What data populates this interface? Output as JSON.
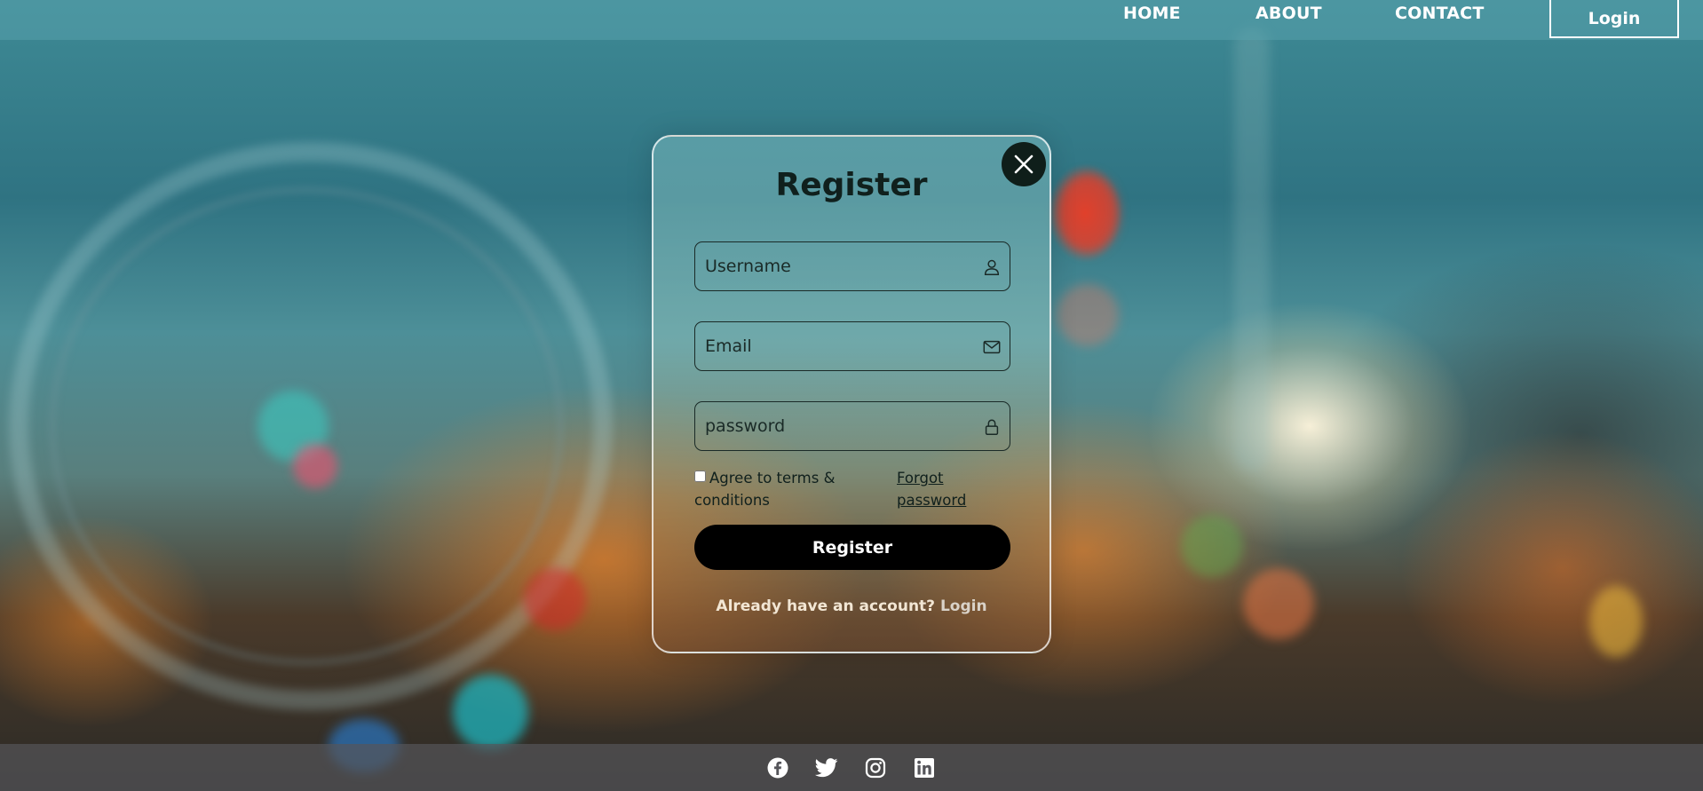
{
  "nav": {
    "links": [
      {
        "label": "HOME"
      },
      {
        "label": "ABOUT"
      },
      {
        "label": "CONTACT"
      }
    ],
    "login_label": "Login"
  },
  "modal": {
    "title": "Register",
    "username_placeholder": "Username",
    "email_placeholder": "Email",
    "password_placeholder": "password",
    "terms_label": "Agree to terms & conditions",
    "forgot_label": "Forgot password",
    "submit_label": "Register",
    "already_text": "Already have an account?",
    "login_link": "Login"
  },
  "icons": {
    "close": "close-icon",
    "username": "user-icon",
    "email": "mail-icon",
    "password": "lock-icon",
    "social": [
      "facebook-icon",
      "twitter-icon",
      "instagram-icon",
      "linkedin-icon"
    ]
  },
  "colors": {
    "submit_button": "#000000",
    "close_button": "#0f1e1a",
    "header_bar": "#58a0ac",
    "text_dark": "#10201d"
  }
}
